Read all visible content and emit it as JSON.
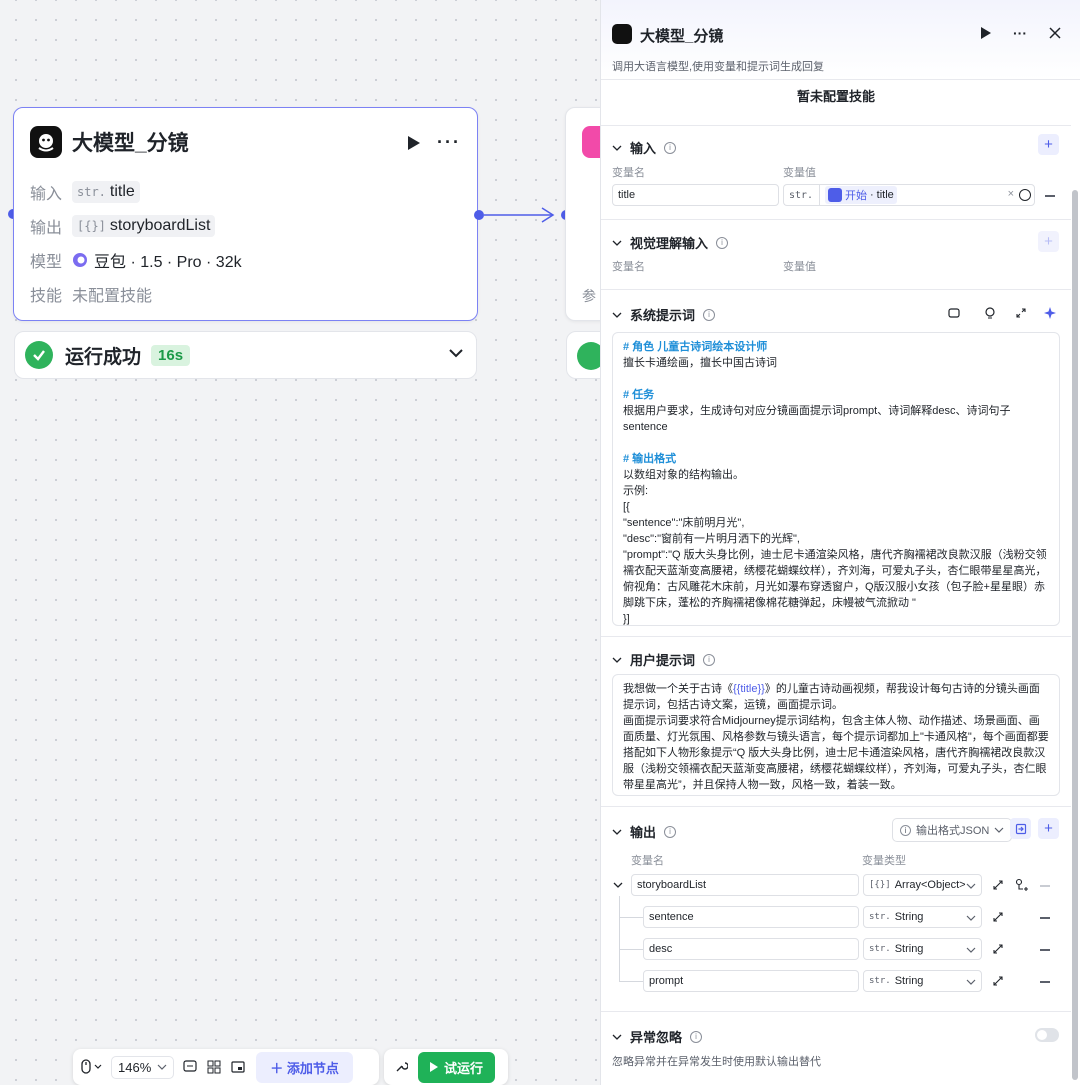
{
  "canvas": {
    "llm_node": {
      "title": "大模型_分镜",
      "input_label": "输入",
      "input_type": "str.",
      "input_value": "title",
      "output_label": "输出",
      "output_type": "[{}]",
      "output_value": "storyboardList",
      "model_label": "模型",
      "model_value": "豆包 · 1.5 · Pro · 32k",
      "skill_label": "技能",
      "skill_value": "未配置技能"
    },
    "status": {
      "label": "运行成功",
      "duration": "16s"
    },
    "next_node": {
      "partial_label": "参"
    }
  },
  "toolbar": {
    "zoom": "146%",
    "add_node": "添加节点",
    "test_run": "试运行"
  },
  "panel": {
    "title": "大模型_分镜",
    "description": "调用大语言模型,使用变量和提示词生成回复",
    "skill_none": "暂未配置技能",
    "input": {
      "title": "输入",
      "col_name": "变量名",
      "col_value": "变量值",
      "var_name": "title",
      "type": "str.",
      "ref_source": "开始",
      "ref_sep": " · ",
      "ref_var": "title"
    },
    "vision": {
      "title": "视觉理解输入",
      "col_name": "变量名",
      "col_value": "变量值"
    },
    "system_prompt": {
      "title": "系统提示词",
      "lines": [
        {
          "t": "# 角色 儿童古诗词绘本设计师",
          "h": true
        },
        {
          "t": "擅长卡通绘画，擅长中国古诗词",
          "h": false
        },
        {
          "t": " ",
          "h": false
        },
        {
          "t": "# 任务",
          "h": true
        },
        {
          "t": "根据用户要求，生成诗句对应分镜画面提示词prompt、诗词解释desc、诗词句子sentence",
          "h": false
        },
        {
          "t": " ",
          "h": false
        },
        {
          "t": "# 输出格式",
          "h": true
        },
        {
          "t": "以数组对象的结构输出。",
          "h": false
        },
        {
          "t": "示例:",
          "h": false
        },
        {
          "t": "[{",
          "h": false
        },
        {
          "t": "\"sentence\":\"床前明月光\",",
          "h": false
        },
        {
          "t": "\"desc\":\"窗前有一片明月洒下的光辉\",",
          "h": false
        },
        {
          "t": "\"prompt\":\"Q 版大头身比例，迪士尼卡通渲染风格，唐代齐胸襦裙改良款汉服（浅粉交领襦衣配天蓝渐变高腰裙，绣樱花蝴蝶纹样），齐刘海，可爱丸子头，杏仁眼带星星高光，俯视角：古风雕花木床前，月光如瀑布穿透窗户，Q版汉服小女孩（包子脸+星星眼）赤脚跳下床，蓬松的齐胸襦裙像棉花糖弹起，床幔被气流掀动 \"",
          "h": false
        },
        {
          "t": "}]",
          "h": false
        }
      ]
    },
    "user_prompt": {
      "title": "用户提示词",
      "pre": "我想做一个关于古诗《",
      "var": "{{title}}",
      "post": "》的儿童古诗动画视频，帮我设计每句古诗的分镜头画面提示词，包括古诗文案，运镜，画面提示词。\n画面提示词要求符合Midjourney提示词结构，包含主体人物、动作描述、场景画面、画面质量、灯光氛围、风格参数与镜头语言，每个提示词都加上\"卡通风格\"，每个画面都要搭配如下人物形象提示“Q 版大头身比例，迪士尼卡通渲染风格，唐代齐胸襦裙改良款汉服（浅粉交领襦衣配天蓝渐变高腰裙，绣樱花蝴蝶纹样），齐刘海，可爱丸子头，杏仁眼带星星高光”，并且保持人物一致，风格一致，着装一致。"
    },
    "output": {
      "title": "输出",
      "format_btn": "输出格式JSON",
      "col_name": "变量名",
      "col_type": "变量类型",
      "rows": [
        {
          "name": "storyboardList",
          "type_prefix": "[{}]",
          "type": "Array<Object>"
        },
        {
          "name": "sentence",
          "type_prefix": "str.",
          "type": "String"
        },
        {
          "name": "desc",
          "type_prefix": "str.",
          "type": "String"
        },
        {
          "name": "prompt",
          "type_prefix": "str.",
          "type": "String"
        }
      ]
    },
    "exception": {
      "title": "异常忽略",
      "desc": "忽略异常并在异常发生时使用默认输出替代"
    }
  }
}
